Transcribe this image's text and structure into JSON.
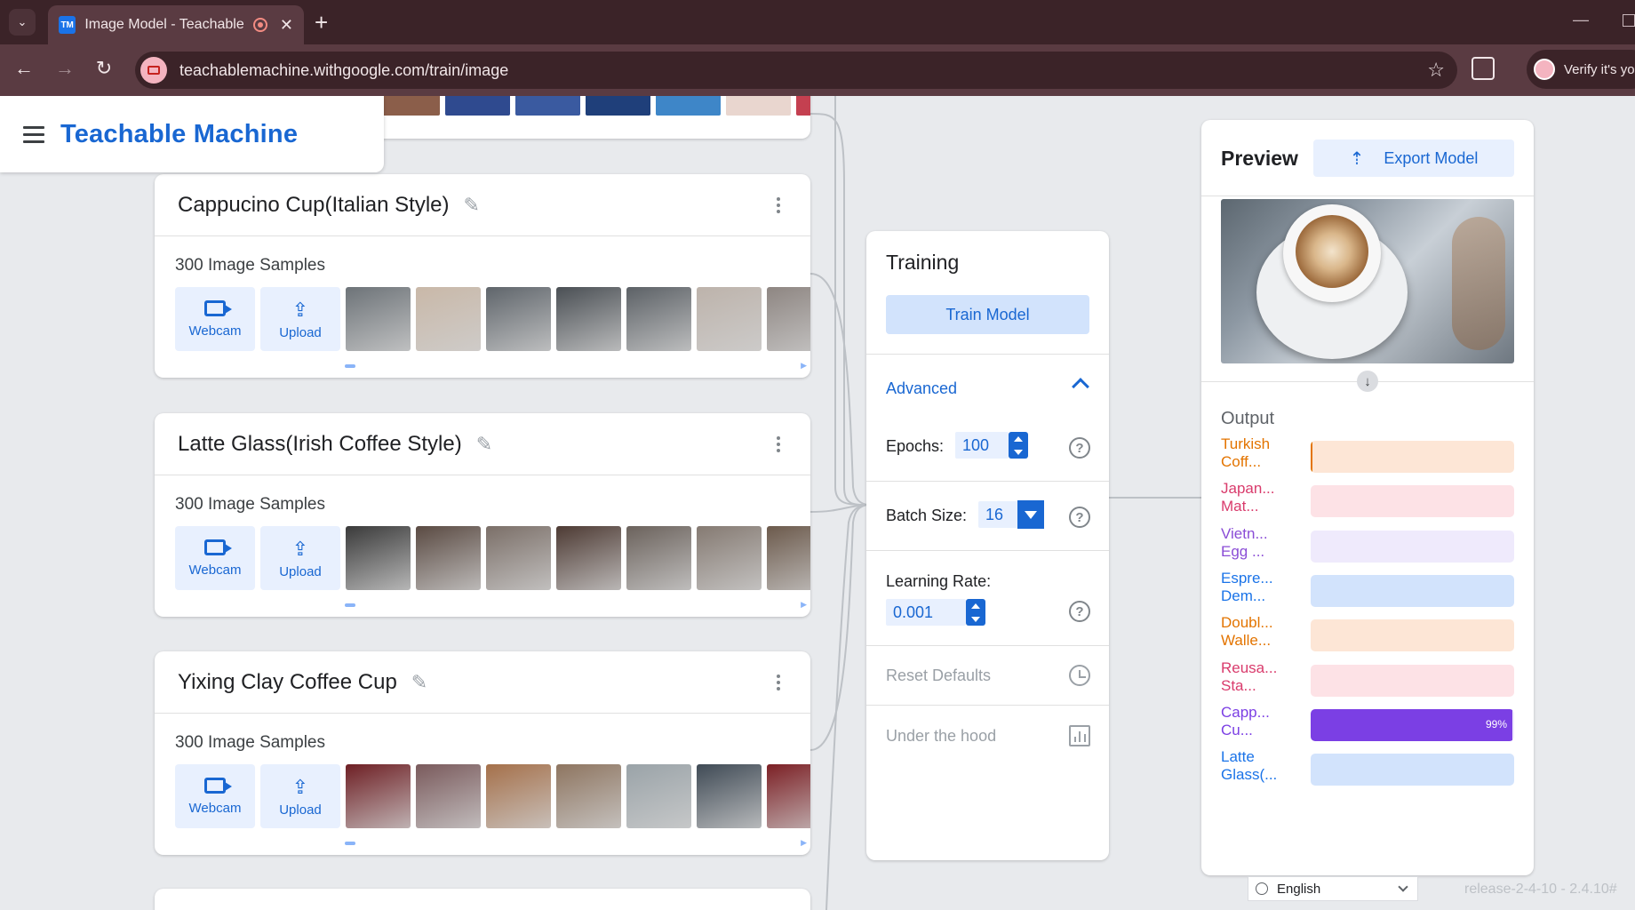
{
  "browser": {
    "tab_title": "Image Model - Teachable M",
    "tab_favicon": "TM",
    "url": "teachablemachine.withgoogle.com/train/image",
    "profile_label": "Verify it's yo"
  },
  "header": {
    "brand": "Teachable Machine"
  },
  "classes": [
    {
      "name": "Cappucino Cup(Italian Style)",
      "samples_label": "300 Image Samples",
      "webcam_label": "Webcam",
      "upload_label": "Upload",
      "thumb_colors": [
        "#6d7378",
        "#c9b8a8",
        "#5f656b",
        "#4a4f54",
        "#5c6166",
        "#bdb3ab",
        "#8e8682"
      ]
    },
    {
      "name": "Latte Glass(Irish Coffee Style)",
      "samples_label": "300 Image Samples",
      "webcam_label": "Webcam",
      "upload_label": "Upload",
      "thumb_colors": [
        "#3a3a3a",
        "#5a4a42",
        "#7b6f68",
        "#4d3a33",
        "#6b625c",
        "#857a72",
        "#6c5a4c"
      ]
    },
    {
      "name": "Yixing Clay Coffee Cup",
      "samples_label": "300 Image Samples",
      "webcam_label": "Webcam",
      "upload_label": "Upload",
      "thumb_colors": [
        "#6e1f24",
        "#7a5a5c",
        "#a5704a",
        "#8e7560",
        "#9aa3a8",
        "#3f4a55",
        "#7c2025"
      ]
    }
  ],
  "top_partial_thumb_colors": [
    "#8b5e4a",
    "#2f4a8f",
    "#3a5aa0",
    "#1f3f7a",
    "#3e86c8",
    "#e9d6cf",
    "#c44050",
    "#3a6fb0"
  ],
  "training": {
    "title": "Training",
    "train_button": "Train Model",
    "advanced_label": "Advanced",
    "epochs_label": "Epochs:",
    "epochs_value": "100",
    "batch_label": "Batch Size:",
    "batch_value": "16",
    "lr_label": "Learning Rate:",
    "lr_value": "0.001",
    "help_glyph": "?",
    "reset_label": "Reset Defaults",
    "hood_label": "Under the hood"
  },
  "preview": {
    "title": "Preview",
    "export_label": "Export Model",
    "output_title": "Output",
    "outputs": [
      {
        "label": "Turkish Coff...",
        "color": "#e37400",
        "bg": "#fde6d6",
        "confidence": 0.01,
        "pct_text": ""
      },
      {
        "label": "Japan... Mat...",
        "color": "#d93b6c",
        "bg": "#fde2e6",
        "confidence": 0,
        "pct_text": ""
      },
      {
        "label": "Vietn... Egg ...",
        "color": "#8a4cd6",
        "bg": "#efeafc",
        "confidence": 0,
        "pct_text": ""
      },
      {
        "label": "Espre... Dem...",
        "color": "#1a73e8",
        "bg": "#d2e3fc",
        "confidence": 0,
        "pct_text": ""
      },
      {
        "label": "Doubl... Walle...",
        "color": "#e37400",
        "bg": "#fde6d6",
        "confidence": 0,
        "pct_text": ""
      },
      {
        "label": "Reusa... Sta...",
        "color": "#d93b6c",
        "bg": "#fde2e6",
        "confidence": 0,
        "pct_text": ""
      },
      {
        "label": "Capp... Cu...",
        "color": "#7b3fe4",
        "bg": "#7b3fe4",
        "confidence": 0.99,
        "pct_text": "99%"
      },
      {
        "label": "Latte Glass(...",
        "color": "#1a73e8",
        "bg": "#d2e3fc",
        "confidence": 0,
        "pct_text": ""
      }
    ]
  },
  "footer": {
    "language": "English",
    "release": "release-2-4-10 - 2.4.10#"
  }
}
